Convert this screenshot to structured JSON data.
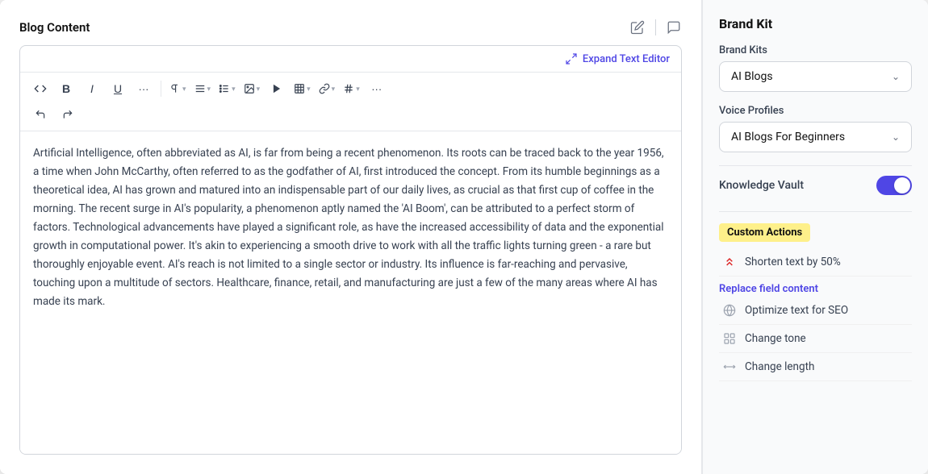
{
  "header": {
    "title": "Blog Content"
  },
  "editor": {
    "expand_label": "Expand Text Editor",
    "toolbar": {
      "row1": [
        {
          "label": "</>",
          "name": "code-btn"
        },
        {
          "label": "B",
          "name": "bold-btn",
          "class": "bold"
        },
        {
          "label": "I",
          "name": "italic-btn",
          "class": "italic"
        },
        {
          "label": "U",
          "name": "underline-btn",
          "class": "underline"
        },
        {
          "label": "···",
          "name": "more1-btn"
        },
        {
          "label": "¶",
          "name": "paragraph-btn",
          "has_arrow": true
        },
        {
          "label": "≡",
          "name": "align-btn",
          "has_arrow": true
        },
        {
          "label": "≔",
          "name": "list-btn",
          "has_arrow": true
        },
        {
          "label": "⛶",
          "name": "image-btn",
          "has_arrow": true
        },
        {
          "label": "▶",
          "name": "media-btn"
        },
        {
          "label": "⊞",
          "name": "table-btn",
          "has_arrow": true
        },
        {
          "label": "🔗",
          "name": "link-btn",
          "has_arrow": true
        },
        {
          "label": "#",
          "name": "hashtag-btn",
          "has_arrow": true
        },
        {
          "label": "···",
          "name": "more2-btn"
        }
      ]
    },
    "content": "Artificial Intelligence, often abbreviated as AI, is far from being a recent phenomenon. Its roots can be traced back to the year 1956, a time when John McCarthy, often referred to as the godfather of AI, first introduced the concept. From its humble beginnings as a theoretical idea, AI has grown and matured into an indispensable part of our daily lives, as crucial as that first cup of coffee in the morning. The recent surge in AI's popularity, a phenomenon aptly named the 'AI Boom', can be attributed to a perfect storm of factors. Technological advancements have played a significant role, as have the increased accessibility of data and the exponential growth in computational power. It's akin to experiencing a smooth drive to work with all the traffic lights turning green - a rare but thoroughly enjoyable event. AI's reach is not limited to a single sector or industry. Its influence is far-reaching and pervasive, touching upon a multitude of sectors. Healthcare, finance, retail, and manufacturing are just a few of the many areas where AI has made its mark."
  },
  "right_panel": {
    "brand_kit_title": "Brand Kit",
    "brand_kits_label": "Brand Kits",
    "brand_kits_value": "AI Blogs",
    "voice_profiles_label": "Voice Profiles",
    "voice_profiles_value": "AI Blogs For Beginners",
    "knowledge_vault_label": "Knowledge Vault",
    "custom_actions_label": "Custom Actions",
    "shorten_text_label": "Shorten text by 50%",
    "replace_field_label": "Replace field content",
    "optimize_seo_label": "Optimize text for SEO",
    "change_tone_label": "Change tone",
    "change_length_label": "Change length"
  }
}
